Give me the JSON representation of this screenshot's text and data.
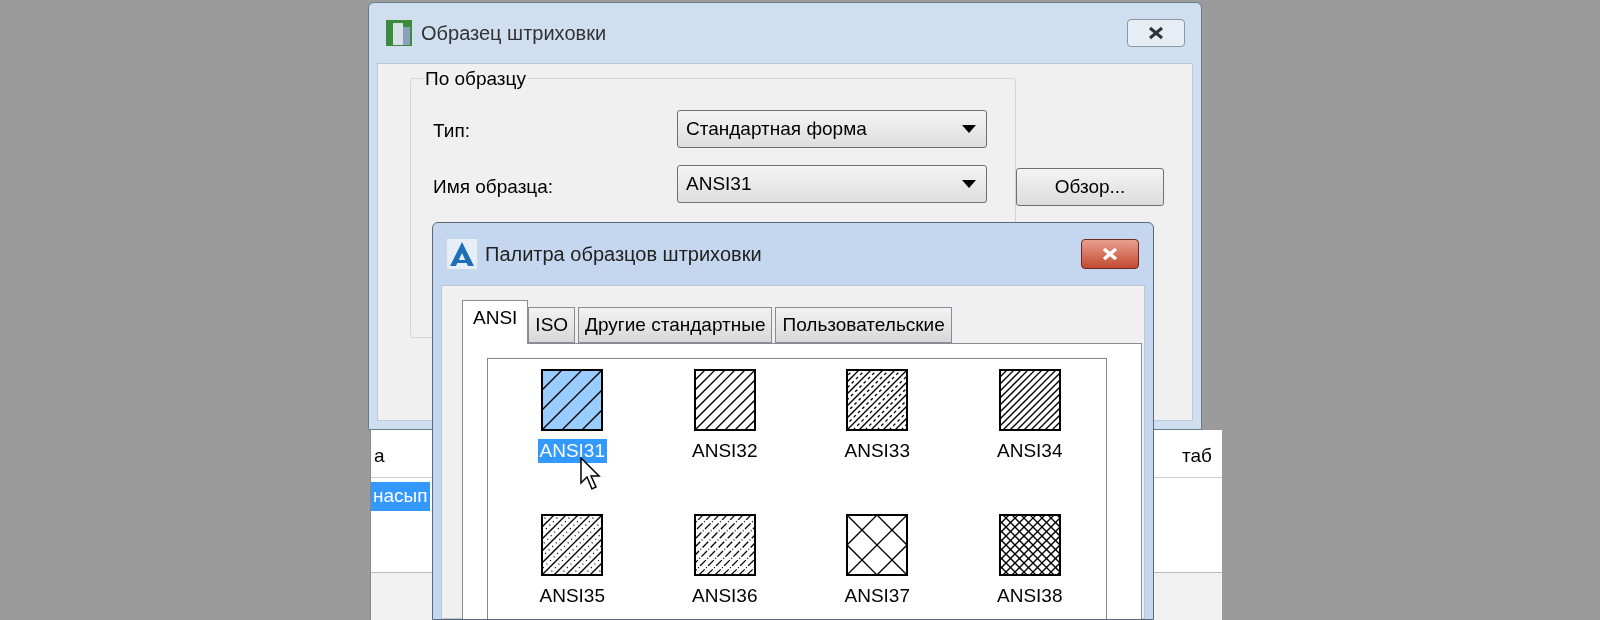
{
  "background_table": {
    "columns": [
      "а",
      "таб"
    ],
    "rows": [
      {
        "cells": [
          "насып"
        ],
        "selected": true
      }
    ]
  },
  "hatch_dialog": {
    "title": "Образец штриховки",
    "group": {
      "title": "По образцу",
      "fields": [
        {
          "label": "Тип:",
          "value": "Стандартная форма"
        },
        {
          "label": "Имя образца:",
          "value": "ANSI31"
        }
      ]
    },
    "browse_button": "Обзор..."
  },
  "palette_dialog": {
    "title": "Палитра образцов штриховки",
    "tabs": [
      {
        "label": "ANSI",
        "selected": true
      },
      {
        "label": "ISO",
        "selected": false
      },
      {
        "label": "Другие стандартные",
        "selected": false
      },
      {
        "label": "Пользовательские",
        "selected": false
      }
    ],
    "patterns": [
      {
        "label": "ANSI31",
        "kind": "single",
        "selected": true
      },
      {
        "label": "ANSI32",
        "kind": "steel",
        "selected": false
      },
      {
        "label": "ANSI33",
        "kind": "dashed",
        "selected": false
      },
      {
        "label": "ANSI34",
        "kind": "dense",
        "selected": false
      },
      {
        "label": "ANSI35",
        "kind": "dotted",
        "selected": false
      },
      {
        "label": "ANSI36",
        "kind": "dashdot",
        "selected": false
      },
      {
        "label": "ANSI37",
        "kind": "cross",
        "selected": false
      },
      {
        "label": "ANSI38",
        "kind": "mesh",
        "selected": false
      }
    ]
  }
}
